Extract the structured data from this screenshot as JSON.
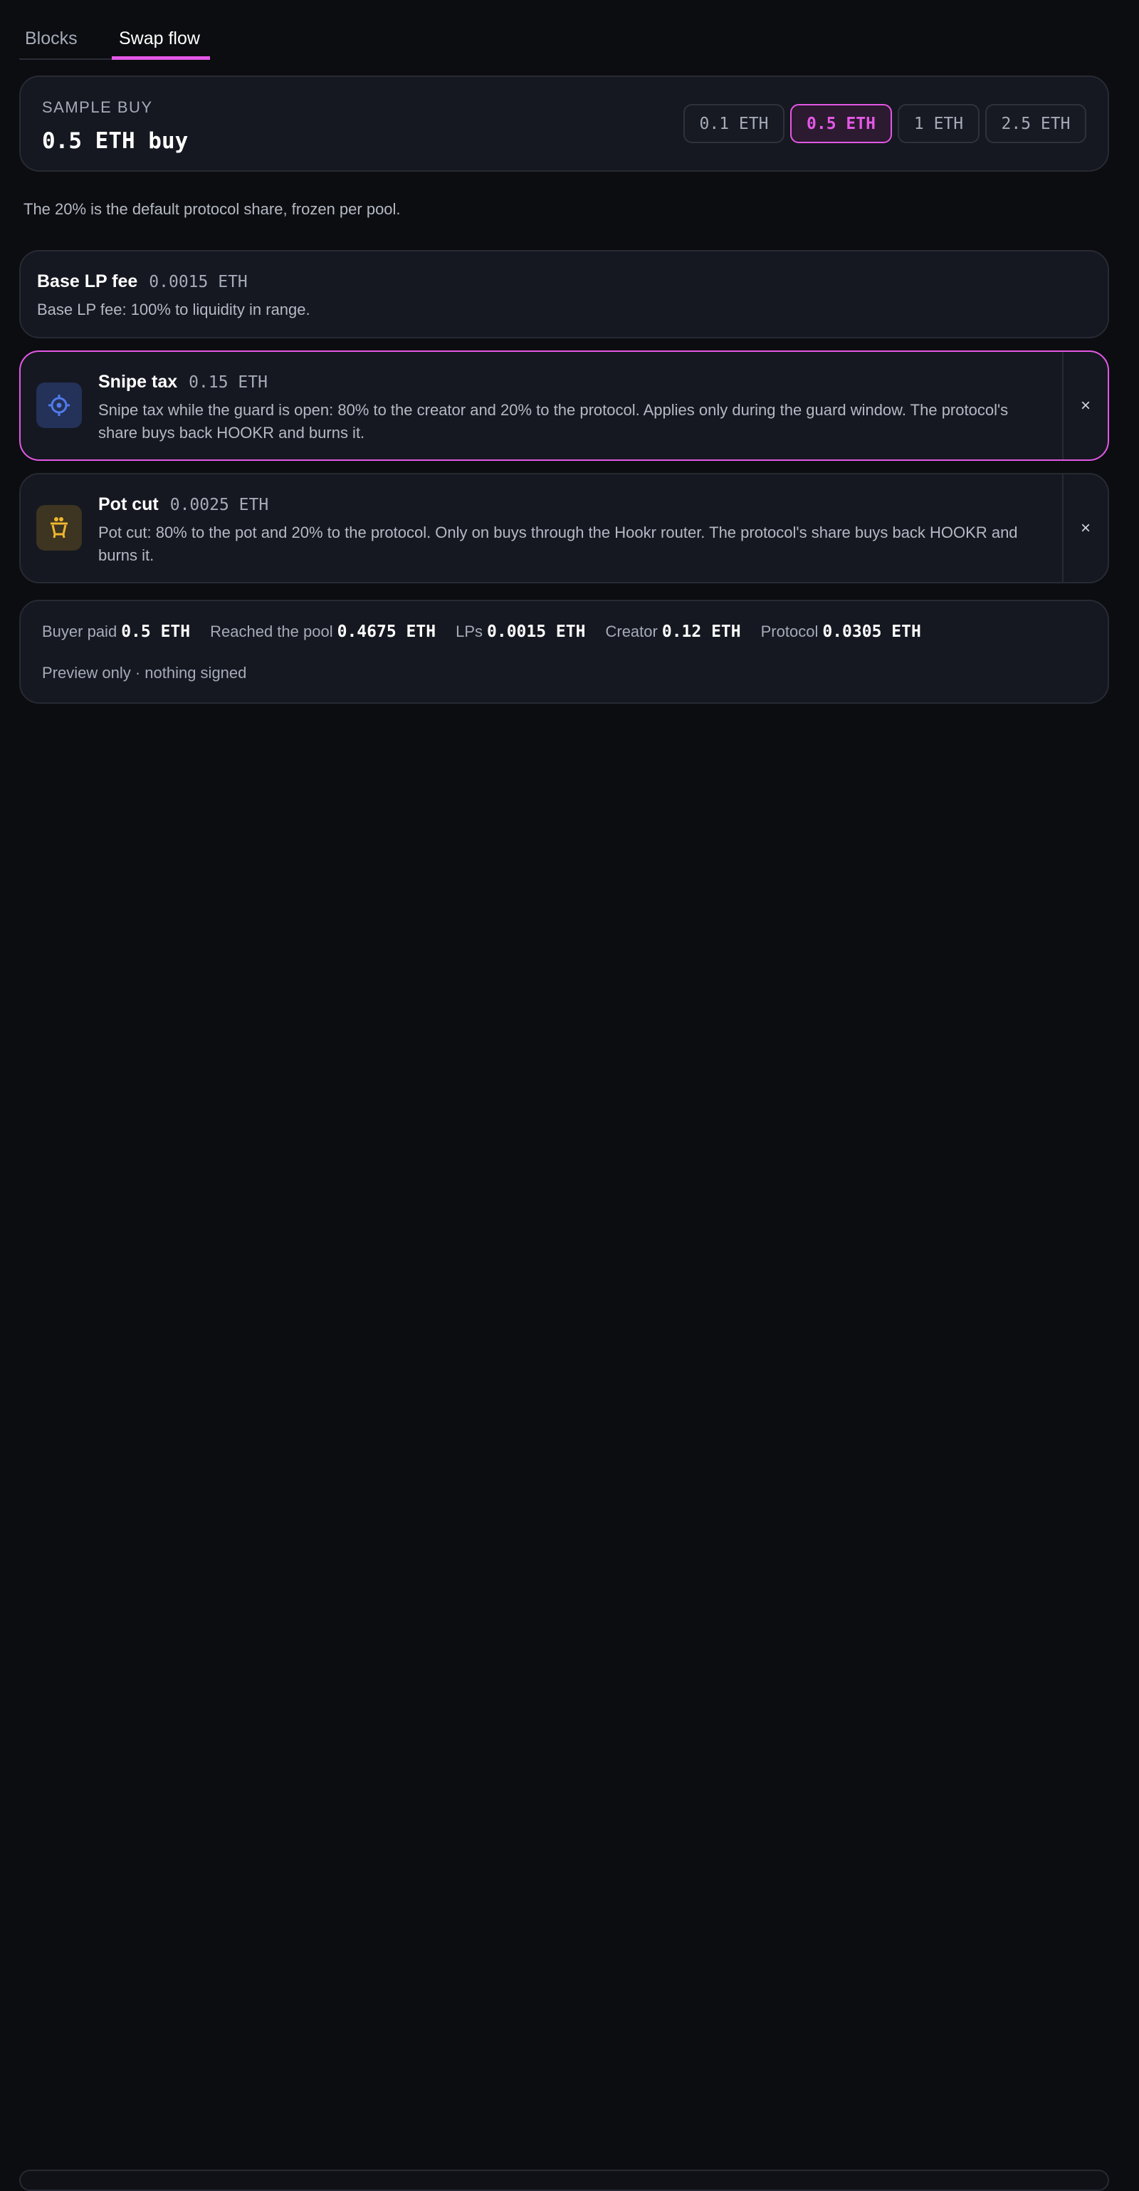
{
  "tabs": [
    {
      "label": "Blocks",
      "active": false
    },
    {
      "label": "Swap flow",
      "active": true
    }
  ],
  "sample_buy": {
    "label": "SAMPLE BUY",
    "value": "0.5 ETH buy",
    "options": [
      "0.1 ETH",
      "0.5 ETH",
      "1 ETH",
      "2.5 ETH"
    ],
    "selected": "0.5 ETH"
  },
  "note": "The 20% is the default protocol share, frozen per pool.",
  "fees": {
    "base": {
      "title": "Base LP fee",
      "amount": "0.0015 ETH",
      "desc": "Base LP fee: 100% to liquidity in range."
    },
    "snipe": {
      "title": "Snipe tax",
      "amount": "0.15 ETH",
      "desc": "Snipe tax while the guard is open: 80% to the creator and 20% to the protocol. Applies only during the guard window. The protocol's share buys back HOOKR and burns it.",
      "icon": "crosshair-icon",
      "close": "×"
    },
    "pot": {
      "title": "Pot cut",
      "amount": "0.0025 ETH",
      "desc": "Pot cut: 80% to the pot and 20% to the protocol. Only on buys through the Hookr router. The protocol's share buys back HOOKR and burns it.",
      "icon": "pot-icon",
      "close": "×"
    }
  },
  "summary": {
    "items": [
      {
        "label": "Buyer paid",
        "value": "0.5 ETH"
      },
      {
        "label": "Reached the pool",
        "value": "0.4675 ETH"
      },
      {
        "label": "LPs",
        "value": "0.0015 ETH"
      },
      {
        "label": "Creator",
        "value": "0.12 ETH"
      },
      {
        "label": "Protocol",
        "value": "0.0305 ETH"
      }
    ],
    "preview": "Preview only · nothing signed"
  },
  "colors": {
    "accent": "#e458e6",
    "background": "#0c0d11",
    "card": "#151820",
    "snipe_icon": "#4f7bea",
    "pot_icon": "#f0b72f"
  }
}
